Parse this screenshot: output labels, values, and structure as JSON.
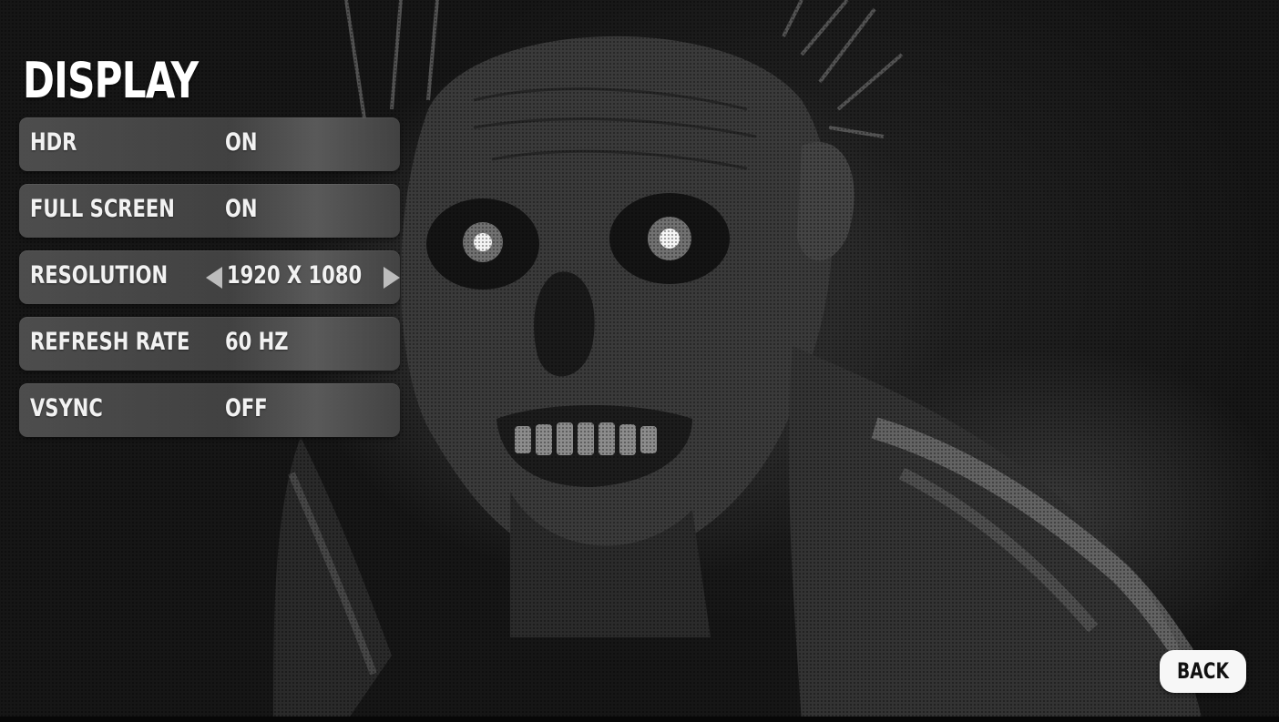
{
  "menu": {
    "title": "DISPLAY",
    "settings": [
      {
        "label": "HDR",
        "value": "ON"
      },
      {
        "label": "FULL SCREEN",
        "value": "ON"
      },
      {
        "label": "RESOLUTION",
        "value": "1920 X 1080"
      },
      {
        "label": "REFRESH RATE",
        "value": "60 HZ"
      },
      {
        "label": "VSYNC",
        "value": "OFF"
      }
    ]
  },
  "footer": {
    "back_label": "BACK"
  },
  "icons": {
    "resolution_prev": "triangle-left-icon",
    "resolution_next": "triangle-right-icon"
  },
  "colors": {
    "text": "#f2f2f2",
    "row_background": "#525252",
    "back_button": "#f7f7f7"
  }
}
